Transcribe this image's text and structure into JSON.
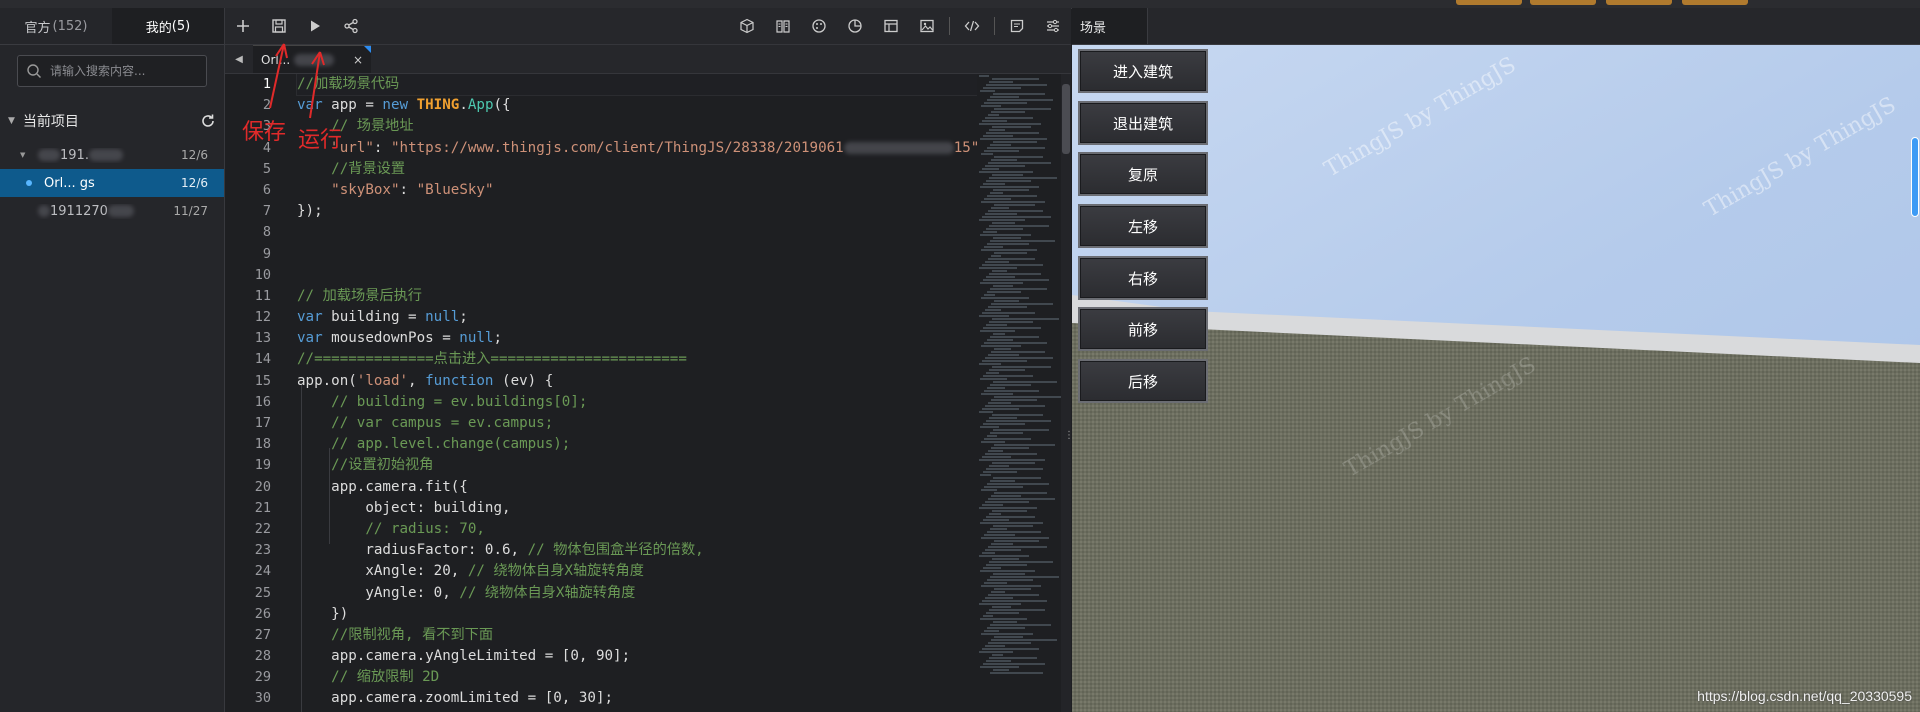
{
  "left": {
    "tabs": [
      {
        "label": "官方",
        "count": "(152)"
      },
      {
        "label": "我的",
        "count": "(5)"
      }
    ],
    "search_placeholder": "请输入搜索内容...",
    "section_title": "当前项目",
    "projects": [
      {
        "name": "191.",
        "date": "12/6"
      },
      {
        "name": "Orl... gs",
        "date": "12/6"
      },
      {
        "name": "1911270",
        "date": "11/27"
      }
    ]
  },
  "editor": {
    "file_tab": "Orl...",
    "close_glyph": "×",
    "line_numbers": [
      "1",
      "2",
      "3",
      "4",
      "5",
      "6",
      "7",
      "8",
      "9",
      "10",
      "11",
      "12",
      "13",
      "14",
      "15",
      "16",
      "17",
      "18",
      "19",
      "20",
      "21",
      "22",
      "23",
      "24",
      "25",
      "26",
      "27",
      "28",
      "29",
      "30"
    ],
    "annotations": {
      "save": "保存",
      "run": "运行"
    }
  },
  "scene": {
    "tab": "场景",
    "buttons": [
      "进入建筑",
      "退出建筑",
      "复原",
      "左移",
      "右移",
      "前移",
      "后移"
    ],
    "watermark": "ThingJS by ThingJS",
    "credit": "https://blog.csdn.net/qq_20330595"
  },
  "colors": {
    "keyword": "#569cd6",
    "string": "#ce9178",
    "comment": "#6a9955",
    "thing": "#f0a030",
    "app_method": "#4ec9b0",
    "selection": "#0e5a8c",
    "annotation": "#e02a2a"
  }
}
